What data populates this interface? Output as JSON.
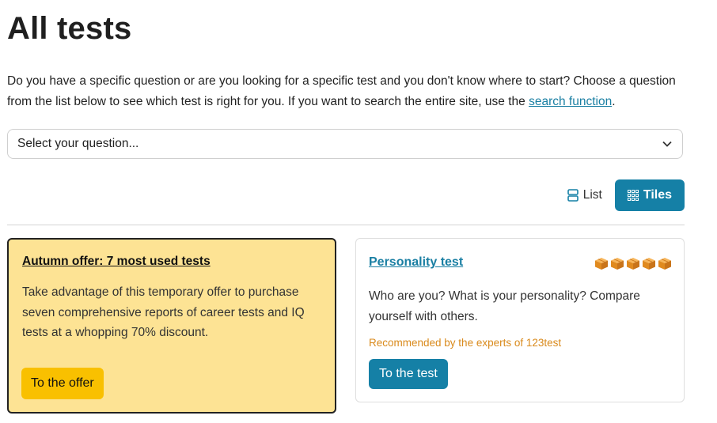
{
  "page": {
    "title": "All tests",
    "intro_text": "Do you have a specific question or are you looking for a specific test and you don't know where to start? Choose a question from the list below to see which test is right for you. If you want to search the entire site, use the ",
    "intro_link": "search function",
    "intro_end": "."
  },
  "question_select": {
    "selected": "Select your question...",
    "icon": "chevron-down-icon"
  },
  "view_toggle": {
    "list_label": "List",
    "list_icon": "list-view-icon",
    "tiles_label": "Tiles",
    "tiles_icon": "grid-view-icon",
    "active": "Tiles",
    "accent": "#1580a6"
  },
  "cards": {
    "offer": {
      "title": "Autumn offer: 7 most used tests",
      "description": "Take advantage of this temporary offer to purchase seven comprehensive reports of career tests and IQ tests at a whopping 70% discount.",
      "button": "To the offer",
      "background": "#fde394",
      "button_color": "#f9c000"
    },
    "test": {
      "title": "Personality test",
      "rating": 5,
      "rating_max": 5,
      "rating_icon": "box-icon",
      "description": "Who are you? What is your personality? Compare yourself with others.",
      "recommendation": "Recommended by the experts of 123test",
      "button": "To the test",
      "recommend_color": "#d98a1c"
    }
  }
}
